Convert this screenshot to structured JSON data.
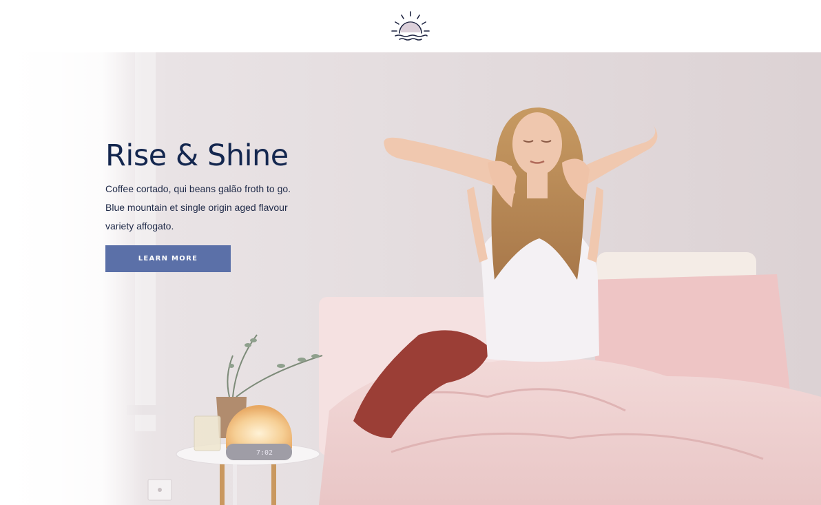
{
  "header": {
    "logo_icon": "sunrise-icon"
  },
  "hero": {
    "title": "Rise & Shine",
    "body": "Coffee cortado, qui beans galão froth to go. Blue mountain et single origin aged flavour variety affogato.",
    "cta_label": "LEARN MORE",
    "clock_display": "7:02",
    "image_subject": "bedroom-morning-stretch-photo"
  },
  "colors": {
    "title": "#14274f",
    "button": "#5b70a8",
    "wall": "#e7dfe0",
    "bedding": "#efd3d3",
    "lamp_glow": "#f6cf95"
  }
}
